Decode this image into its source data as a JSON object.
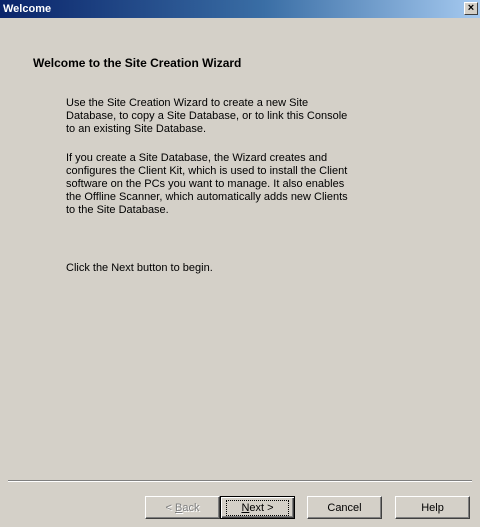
{
  "window": {
    "title": "Welcome",
    "close_label": "×"
  },
  "content": {
    "heading": "Welcome to the Site Creation Wizard",
    "paragraphs": [
      [
        "Use the Site Creation Wizard to create a new Site",
        "Database, to copy a Site Database, or to link this Console",
        "to an existing Site Database."
      ],
      [
        "If you create a Site Database, the Wizard creates and",
        "configures the Client Kit, which is used to install the Client",
        "software on the PCs you want to manage. It also enables",
        "the Offline Scanner, which automatically adds new Clients",
        "to the Site Database."
      ],
      [
        "Click the Next button to begin."
      ]
    ]
  },
  "buttons": {
    "back": {
      "prefix": "< ",
      "mnemonic": "B",
      "rest": "ack",
      "enabled": false
    },
    "next": {
      "mnemonic": "N",
      "rest": "ext >",
      "default": true
    },
    "cancel": {
      "label": "Cancel"
    },
    "help": {
      "label": "Help"
    }
  }
}
